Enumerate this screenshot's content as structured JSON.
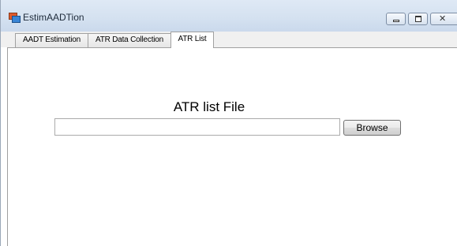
{
  "window": {
    "title": "EstimAADTion"
  },
  "tabs": [
    {
      "label": "AADT Estimation",
      "active": false
    },
    {
      "label": "ATR Data Collection",
      "active": false
    },
    {
      "label": "ATR List",
      "active": true
    }
  ],
  "atr_list": {
    "heading": "ATR list File",
    "file_path_value": "",
    "browse_label": "Browse"
  },
  "icons": {
    "app": "app-window-icon",
    "minimize": "minimize-icon",
    "maximize": "maximize-icon",
    "close": "close-icon"
  },
  "colors": {
    "titlebar": "#d4e1f0",
    "panel": "#ffffff",
    "tab_border": "#a0a0a0"
  }
}
